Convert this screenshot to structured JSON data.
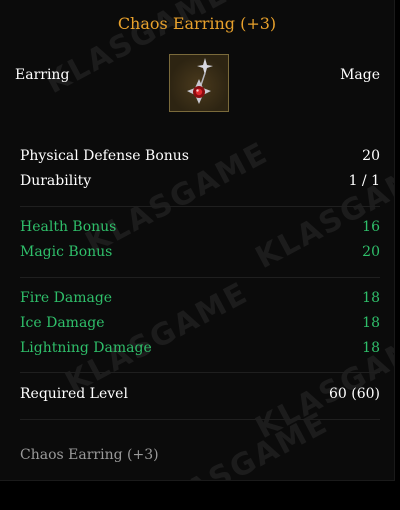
{
  "tooltip": {
    "title": "Chaos Earring (+3)",
    "item_type": "Earring",
    "item_class": "Mage",
    "icon": "chaos-earring-icon",
    "base_stats": [
      {
        "label": "Physical Defense Bonus",
        "value": "20"
      },
      {
        "label": "Durability",
        "value": "1 / 1"
      }
    ],
    "bonus_stats": [
      {
        "label": "Health Bonus",
        "value": "16"
      },
      {
        "label": "Magic Bonus",
        "value": "20"
      }
    ],
    "damage_stats": [
      {
        "label": "Fire Damage",
        "value": "18"
      },
      {
        "label": "Ice Damage",
        "value": "18"
      },
      {
        "label": "Lightning Damage",
        "value": "18"
      }
    ],
    "requirement": {
      "label": "Required Level",
      "value": "60 (60)"
    },
    "footer_name": "Chaos Earring (+3)",
    "watermark_text": "KLASGAME",
    "colors": {
      "title": "#e8a12c",
      "normal_text": "#ffffff",
      "bonus_text": "#2fbf6a",
      "footer_text": "#9a9a9a",
      "background": "#0b0b0b"
    }
  }
}
